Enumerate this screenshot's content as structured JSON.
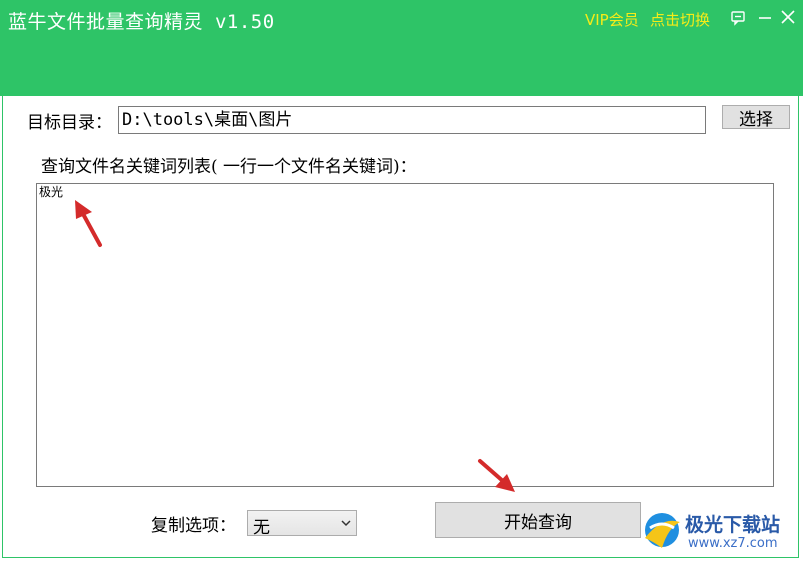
{
  "window": {
    "title": "蓝牛文件批量查询精灵 v1.50",
    "vip_label": "VIP会员",
    "switch_label": "点击切换",
    "theme_color": "#2ec467",
    "link_color": "#f5ec18"
  },
  "form": {
    "target_dir_label": "目标目录：",
    "target_dir_value": "D:\\tools\\桌面\\图片",
    "select_button": "选择",
    "keywords_label": "查询文件名关键词列表( 一行一个文件名关键词)：",
    "keywords_value": "极光",
    "copy_option_label": "复制选项：",
    "copy_option_value": "无",
    "start_button": "开始查询"
  },
  "icons": {
    "feedback": "feedback-icon",
    "minimize": "minimize-icon",
    "close": "close-icon",
    "dropdown": "chevron-down-icon",
    "annotation": "red-arrow-icon"
  },
  "watermark": {
    "name": "极光下载站",
    "url": "www.xz7.com"
  }
}
